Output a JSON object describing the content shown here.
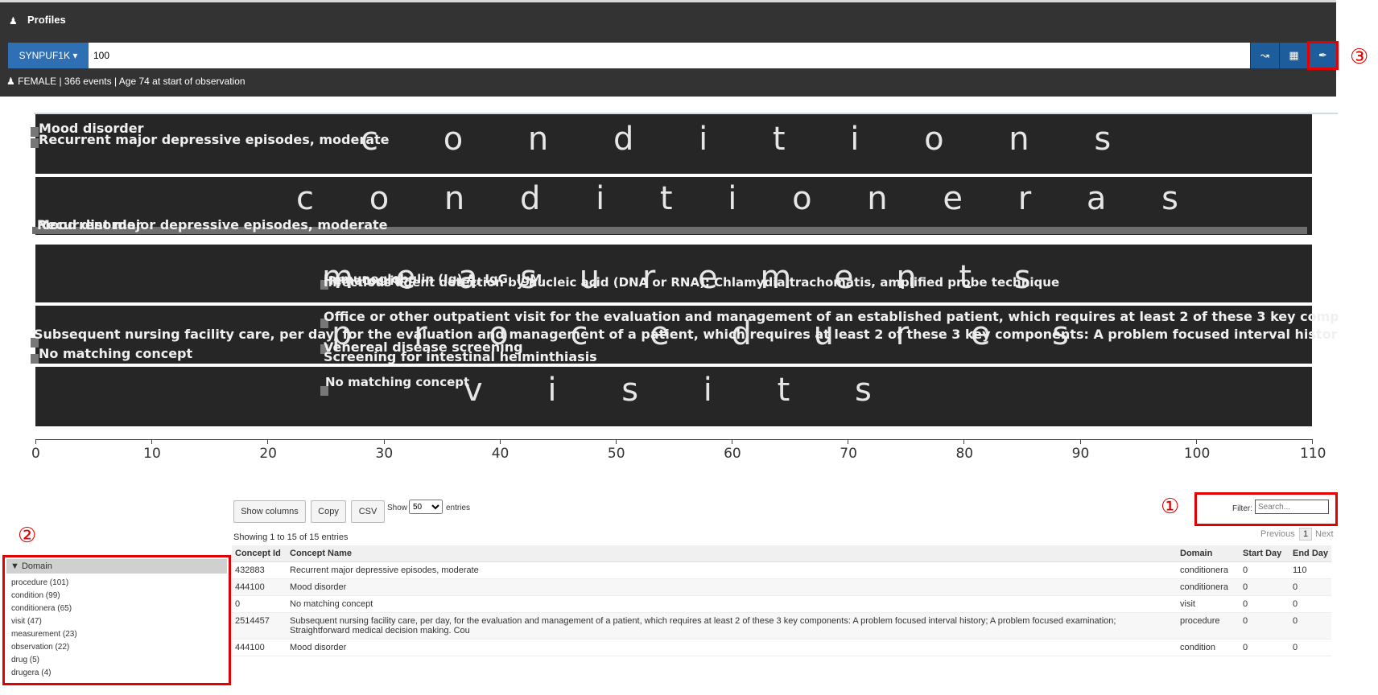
{
  "header": {
    "title": "Profiles",
    "user_icon": "user-icon"
  },
  "search": {
    "source_label": "SYNPUF1K",
    "person_id": "100",
    "toolbar_icons": [
      "line-chart-icon",
      "table-icon",
      "brush-icon"
    ]
  },
  "person_info": {
    "gender": "FEMALE",
    "events": "366 events",
    "age": "Age 74 at start of observation"
  },
  "annotations": {
    "mark1": "①",
    "mark2": "②",
    "mark3": "③"
  },
  "chart": {
    "rows": [
      {
        "domain": "conditions",
        "spaced": "c o n d i t i o n s",
        "labels": [
          "Mood disorder",
          "Recurrent major depressive episodes, moderate"
        ]
      },
      {
        "domain": "conditioneras",
        "spaced": "c o n d i t i o n e r a s",
        "labels": [
          "Mood disorder",
          "Recurrent major depressive episodes, moderate"
        ]
      },
      {
        "domain": "measurements",
        "spaced": "m e a s u r e m e n t s",
        "labels": [
          "Infectious agent detection by nucleic acid (DNA or RNA); Chlamydia trachomatis, amplified probe technique",
          "Hematocrit",
          "Immunoglobulin (Ig) A, IgG, IgM"
        ]
      },
      {
        "domain": "procedures",
        "spaced": "p r o c e d u r e s",
        "labels": [
          "Office or other outpatient visit for the evaluation and management of an established patient, which requires at least 2 of these 3 key components: A detailed histo",
          "Subsequent nursing facility care, per day, for the evaluation and management of a patient, which requires at least 2 of these 3 key components: A problem focused interval history; A problem focused examina",
          "Venereal disease screening",
          "Screening for intestinal helminthiasis"
        ]
      },
      {
        "domain": "visits",
        "spaced": "v i s i t s",
        "labels": [
          "No matching concept",
          "No matching concept"
        ]
      }
    ],
    "axis_ticks": [
      "0",
      "10",
      "20",
      "30",
      "40",
      "50",
      "60",
      "70",
      "80",
      "90",
      "100",
      "110"
    ]
  },
  "table_controls": {
    "show_columns": "Show columns",
    "copy": "Copy",
    "csv": "CSV",
    "show": "Show",
    "page_size": "50",
    "entries": "entries",
    "filter_label": "Filter:",
    "filter_placeholder": "Search...",
    "showing": "Showing 1 to 15 of 15 entries",
    "previous": "Previous",
    "page": "1",
    "next": "Next"
  },
  "domain_filter": {
    "title": "Domain",
    "items": [
      "procedure (101)",
      "condition (99)",
      "conditionera (65)",
      "visit (47)",
      "measurement (23)",
      "observation (22)",
      "drug (5)",
      "drugera (4)"
    ]
  },
  "table": {
    "columns": [
      "Concept Id",
      "Concept Name",
      "Domain",
      "Start Day",
      "End Day"
    ],
    "rows": [
      [
        "432883",
        "Recurrent major depressive episodes, moderate",
        "conditionera",
        "0",
        "110"
      ],
      [
        "444100",
        "Mood disorder",
        "conditionera",
        "0",
        "0"
      ],
      [
        "0",
        "No matching concept",
        "visit",
        "0",
        "0"
      ],
      [
        "2514457",
        "Subsequent nursing facility care, per day, for the evaluation and management of a patient, which requires at least 2 of these 3 key components: A problem focused interval history; A problem focused examination; Straightforward medical decision making. Cou",
        "procedure",
        "0",
        "0"
      ],
      [
        "444100",
        "Mood disorder",
        "condition",
        "0",
        "0"
      ]
    ]
  }
}
